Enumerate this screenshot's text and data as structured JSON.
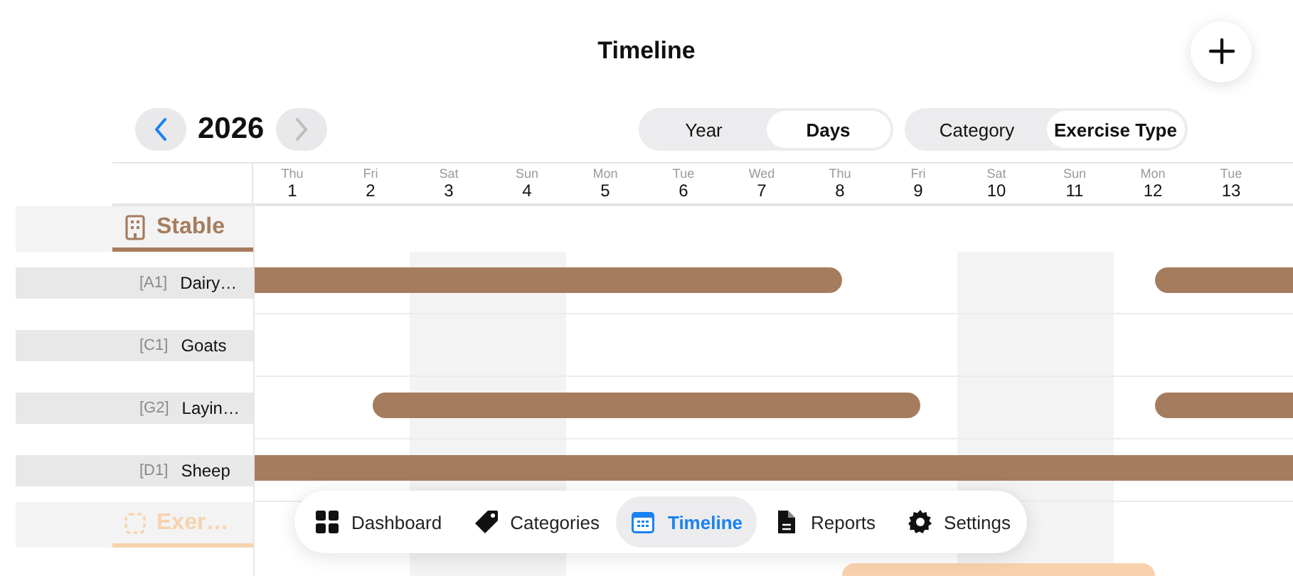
{
  "title": "Timeline",
  "year_nav": {
    "year": "2026",
    "prev_disabled": false,
    "next_disabled": true
  },
  "view_toggle": [
    {
      "label": "Year",
      "selected": false
    },
    {
      "label": "Days",
      "selected": true
    }
  ],
  "group_toggle": [
    {
      "label": "Category",
      "selected": false
    },
    {
      "label": "Exercise Type",
      "selected": true
    }
  ],
  "days": [
    {
      "weekday": "Thu",
      "day": "1",
      "weekend": false
    },
    {
      "weekday": "Fri",
      "day": "2",
      "weekend": false
    },
    {
      "weekday": "Sat",
      "day": "3",
      "weekend": true
    },
    {
      "weekday": "Sun",
      "day": "4",
      "weekend": true
    },
    {
      "weekday": "Mon",
      "day": "5",
      "weekend": false
    },
    {
      "weekday": "Tue",
      "day": "6",
      "weekend": false
    },
    {
      "weekday": "Wed",
      "day": "7",
      "weekend": false
    },
    {
      "weekday": "Thu",
      "day": "8",
      "weekend": false
    },
    {
      "weekday": "Fri",
      "day": "9",
      "weekend": false
    },
    {
      "weekday": "Sat",
      "day": "10",
      "weekend": true
    },
    {
      "weekday": "Sun",
      "day": "11",
      "weekend": true
    },
    {
      "weekday": "Mon",
      "day": "12",
      "weekend": false
    },
    {
      "weekday": "Tue",
      "day": "13",
      "weekend": false
    }
  ],
  "sections": [
    {
      "title": "Stable",
      "kind": "building",
      "color": "#a67c5e",
      "rows": [
        {
          "code": "[A1]",
          "name": "Dairy…",
          "halves": [
            true,
            true,
            true,
            true,
            true,
            true,
            true,
            true,
            true,
            true,
            true,
            true,
            true,
            true,
            true,
            false,
            false,
            false,
            false,
            false,
            false,
            false,
            false,
            true,
            true,
            true
          ]
        },
        {
          "code": "[C1]",
          "name": "Goats",
          "halves": [
            false,
            false,
            false,
            false,
            false,
            false,
            false,
            false,
            false,
            false,
            false,
            false,
            false,
            false,
            false,
            false,
            false,
            false,
            false,
            false,
            false,
            false,
            false,
            false,
            false,
            false
          ]
        },
        {
          "code": "[G2]",
          "name": "Layin…",
          "halves": [
            false,
            false,
            false,
            true,
            true,
            true,
            true,
            true,
            true,
            true,
            true,
            true,
            true,
            true,
            true,
            true,
            true,
            false,
            false,
            false,
            false,
            false,
            false,
            true,
            true,
            true
          ]
        },
        {
          "code": "[D1]",
          "name": "Sheep",
          "halves": [
            true,
            true,
            true,
            true,
            true,
            true,
            true,
            true,
            true,
            true,
            true,
            true,
            true,
            true,
            true,
            true,
            true,
            true,
            true,
            true,
            true,
            true,
            true,
            true,
            true,
            true
          ]
        }
      ]
    },
    {
      "title": "Exer…",
      "kind": "dashed",
      "color": "#f8d2ad",
      "rows": [
        {
          "halves": [
            false,
            false,
            false,
            false,
            false,
            false,
            false,
            false,
            false,
            false,
            false,
            false,
            false,
            false,
            false,
            true,
            true,
            true,
            true,
            true,
            true,
            true,
            true,
            false,
            false,
            false
          ]
        }
      ]
    }
  ],
  "tabs": [
    {
      "label": "Dashboard",
      "kind": "grid",
      "selected": false
    },
    {
      "label": "Categories",
      "kind": "tag",
      "selected": false
    },
    {
      "label": "Timeline",
      "kind": "calendar",
      "selected": true
    },
    {
      "label": "Reports",
      "kind": "document",
      "selected": false
    },
    {
      "label": "Settings",
      "kind": "gear",
      "selected": false
    }
  ]
}
